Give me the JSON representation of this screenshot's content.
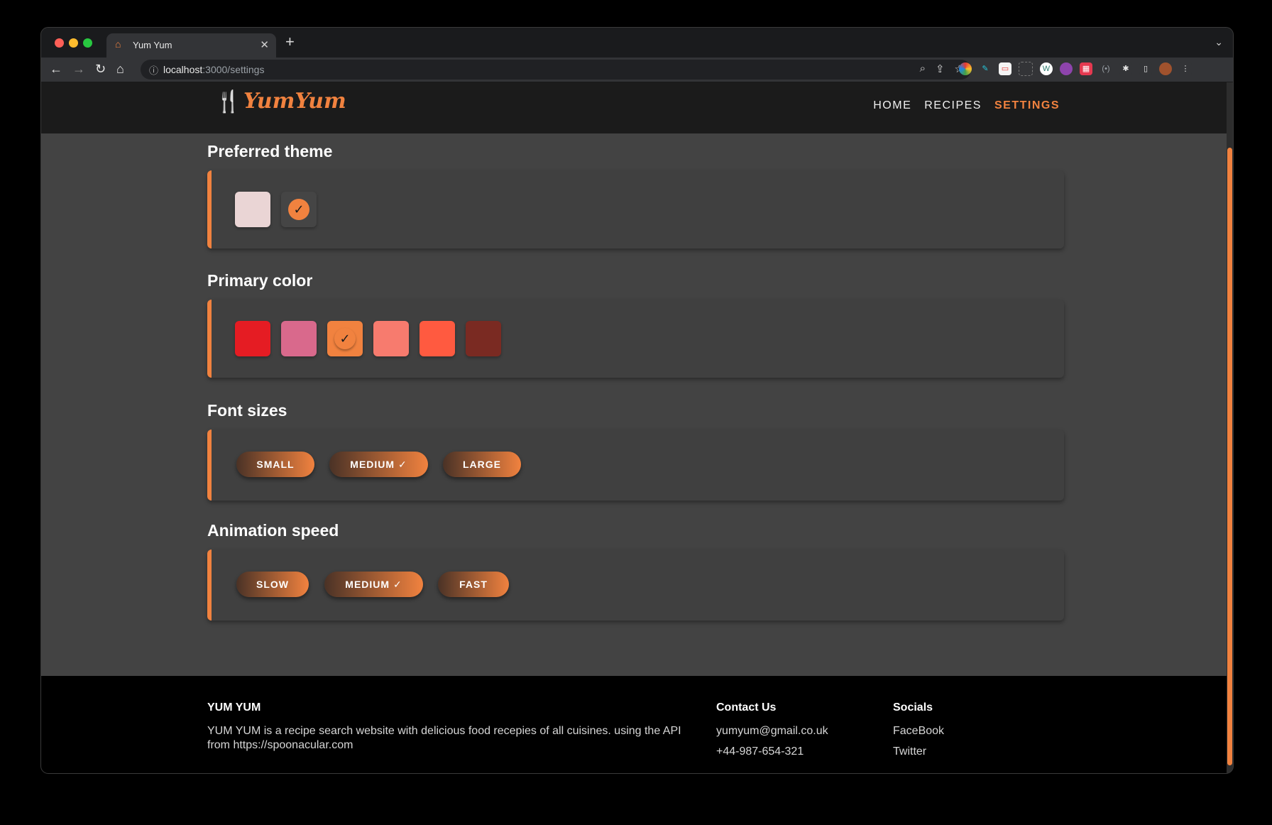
{
  "browser": {
    "tab_title": "Yum Yum",
    "url_host": "localhost",
    "url_rest": ":3000/settings"
  },
  "site": {
    "logo_text": "YumYum",
    "nav": {
      "home": "HOME",
      "recipes": "RECIPES",
      "settings": "SETTINGS"
    }
  },
  "settings": {
    "theme": {
      "title": "Preferred theme",
      "options": [
        {
          "color": "#ead5d5",
          "selected": false
        },
        {
          "color": "#454545",
          "selected": true
        }
      ]
    },
    "primary_color": {
      "title": "Primary color",
      "options": [
        {
          "color": "#e51c23",
          "selected": false
        },
        {
          "color": "#d9698c",
          "selected": false
        },
        {
          "color": "#f1823f",
          "selected": true
        },
        {
          "color": "#f77b6e",
          "selected": false
        },
        {
          "color": "#ff5a40",
          "selected": false
        },
        {
          "color": "#7a2a22",
          "selected": false
        }
      ]
    },
    "font_sizes": {
      "title": "Font sizes",
      "small": "SMALL",
      "medium": "MEDIUM ✓",
      "large": "LARGE"
    },
    "animation_speed": {
      "title": "Animation speed",
      "slow": "SLOW",
      "medium": "MEDIUM ✓",
      "fast": "FAST"
    }
  },
  "footer": {
    "brand_title": "YUM YUM",
    "description": "YUM YUM is a recipe search website with delicious food recepies of all cuisines. using the API from https://spoonacular.com",
    "contact_title": "Contact Us",
    "email": "yumyum@gmail.co.uk",
    "phone": "+44-987-654-321",
    "socials_title": "Socials",
    "facebook": "FaceBook",
    "twitter": "Twitter"
  },
  "colors": {
    "accent": "#f1823f",
    "page_bg": "#434343",
    "header_bg": "#1b1b1b"
  }
}
